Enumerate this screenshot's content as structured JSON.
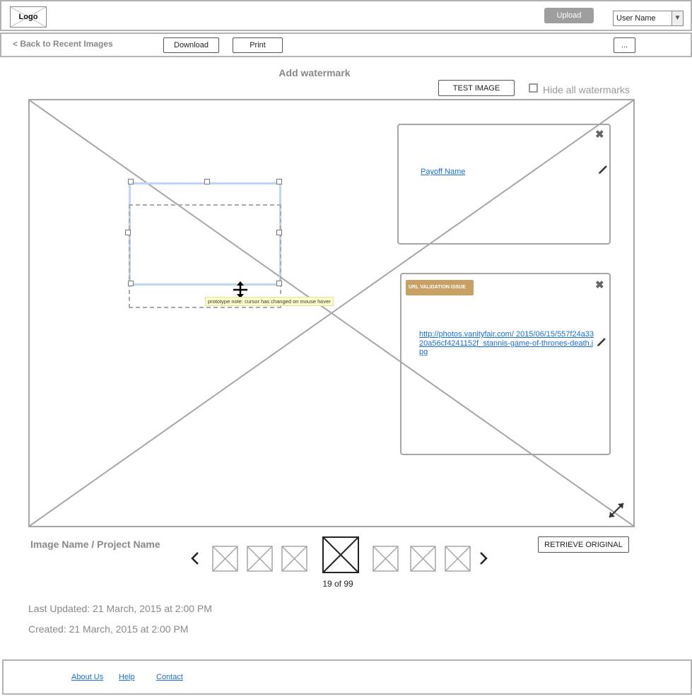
{
  "header": {
    "logo": "Logo",
    "upload_label": "Upload",
    "user_name": "User Name"
  },
  "toolbar": {
    "back_label": "< Back to Recent Images",
    "download_label": "Download",
    "print_label": "Print",
    "more_label": "..."
  },
  "editor": {
    "title": "Add watermark",
    "test_image_label": "TEST IMAGE",
    "hide_watermarks_label": "Hide all watermarks",
    "hide_watermarks_checked": false,
    "prototype_note": "prototype note: cursor has changed on mouse hover"
  },
  "panels": {
    "payoff": {
      "link": "Payoff Name"
    },
    "url": {
      "badge": "URL VALIDATION ISSUE",
      "link": "http://photos.vanityfair.com/ 2015/06/15/557f24a3320a56cf4241152f_stannis-game-of-thrones-death.jpg"
    }
  },
  "filmstrip": {
    "image_name": "Image Name / Project Name",
    "counter": "19 of 99",
    "retrieve_label": "RETRIEVE ORIGINAL",
    "prev_icon": "chevron-left-icon",
    "next_icon": "chevron-right-icon"
  },
  "meta": {
    "last_updated": "Last Updated: 21 March, 2015 at 2:00 PM",
    "created": "Created: 21 March, 2015 at 2:00 PM"
  },
  "footer": {
    "about": "About Us",
    "help": "Help",
    "contact": "Contact"
  },
  "colors": {
    "badge_bg": "#c8a064",
    "link": "#1a6ed8",
    "selection": "#bcd6f5",
    "upload_bg": "#9e9e9e"
  }
}
